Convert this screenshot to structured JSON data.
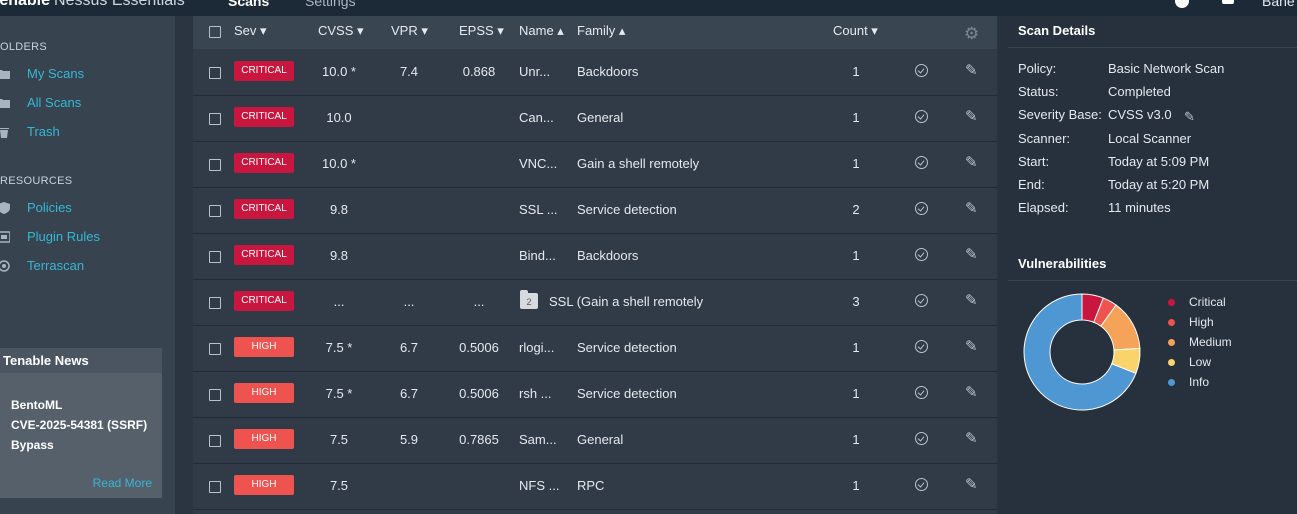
{
  "topbar": {
    "brand": "tenable",
    "product": "Nessus Essentials",
    "tabs": [
      "Scans",
      "Settings"
    ],
    "user": "Bane"
  },
  "sidebar": {
    "folders_heading": "OLDERS",
    "folders": [
      "My Scans",
      "All Scans",
      "Trash"
    ],
    "resources_heading": "RESOURCES",
    "resources": [
      "Policies",
      "Plugin Rules",
      "Terrascan"
    ],
    "news": {
      "heading": "Tenable News",
      "lines": [
        "BentoML",
        "CVE-2025-54381 (SSRF)",
        "Bypass"
      ],
      "read_more": "Read More"
    }
  },
  "table": {
    "headers": {
      "sev": "Sev ▾",
      "cvss": "CVSS ▾",
      "vpr": "VPR ▾",
      "epss": "EPSS ▾",
      "name": "Name ▴",
      "family": "Family ▴",
      "count": "Count ▾"
    },
    "rows": [
      {
        "sev": "CRITICAL",
        "level": "critical",
        "cvss": "10.0 *",
        "vpr": "7.4",
        "epss": "0.868",
        "name": "Unr...",
        "family": "Backdoors",
        "count": "1"
      },
      {
        "sev": "CRITICAL",
        "level": "critical",
        "cvss": "10.0",
        "vpr": "",
        "epss": "",
        "name": "Can...",
        "family": "General",
        "count": "1"
      },
      {
        "sev": "CRITICAL",
        "level": "critical",
        "cvss": "10.0 *",
        "vpr": "",
        "epss": "",
        "name": "VNC...",
        "family": "Gain a shell remotely",
        "count": "1"
      },
      {
        "sev": "CRITICAL",
        "level": "critical",
        "cvss": "9.8",
        "vpr": "",
        "epss": "",
        "name": "SSL ...",
        "family": "Service detection",
        "count": "2"
      },
      {
        "sev": "CRITICAL",
        "level": "critical",
        "cvss": "9.8",
        "vpr": "",
        "epss": "",
        "name": "Bind...",
        "family": "Backdoors",
        "count": "1"
      },
      {
        "sev": "CRITICAL",
        "level": "critical",
        "cvss": "...",
        "vpr": "...",
        "epss": "...",
        "name": "",
        "family": "SSL (Gain a shell remotely",
        "folder_count": "2",
        "count": "3"
      },
      {
        "sev": "HIGH",
        "level": "high",
        "cvss": "7.5 *",
        "vpr": "6.7",
        "epss": "0.5006",
        "name": "rlogi...",
        "family": "Service detection",
        "count": "1"
      },
      {
        "sev": "HIGH",
        "level": "high",
        "cvss": "7.5 *",
        "vpr": "6.7",
        "epss": "0.5006",
        "name": "rsh ...",
        "family": "Service detection",
        "count": "1"
      },
      {
        "sev": "HIGH",
        "level": "high",
        "cvss": "7.5",
        "vpr": "5.9",
        "epss": "0.7865",
        "name": "Sam...",
        "family": "General",
        "count": "1"
      },
      {
        "sev": "HIGH",
        "level": "high",
        "cvss": "7.5",
        "vpr": "",
        "epss": "",
        "name": "NFS ...",
        "family": "RPC",
        "count": "1"
      }
    ]
  },
  "scan_details": {
    "title": "Scan Details",
    "fields": [
      {
        "k": "Policy:",
        "v": "Basic Network Scan"
      },
      {
        "k": "Status:",
        "v": "Completed"
      },
      {
        "k": "Severity Base:",
        "v": "CVSS v3.0"
      },
      {
        "k": "Scanner:",
        "v": "Local Scanner"
      },
      {
        "k": "Start:",
        "v": "Today at 5:09 PM"
      },
      {
        "k": "End:",
        "v": "Today at 5:20 PM"
      },
      {
        "k": "Elapsed:",
        "v": "11 minutes"
      }
    ]
  },
  "vulnerabilities": {
    "title": "Vulnerabilities",
    "colors": {
      "critical": "#c8163e",
      "high": "#ef5350",
      "medium": "#f6a35a",
      "low": "#f8d46a",
      "info": "#4f97d2"
    },
    "legend": [
      "Critical",
      "High",
      "Medium",
      "Low",
      "Info"
    ]
  },
  "chart_data": {
    "type": "pie",
    "categories": [
      "Critical",
      "High",
      "Medium",
      "Low",
      "Info"
    ],
    "values": [
      6,
      4,
      14,
      7,
      69
    ],
    "title": "Vulnerabilities"
  }
}
